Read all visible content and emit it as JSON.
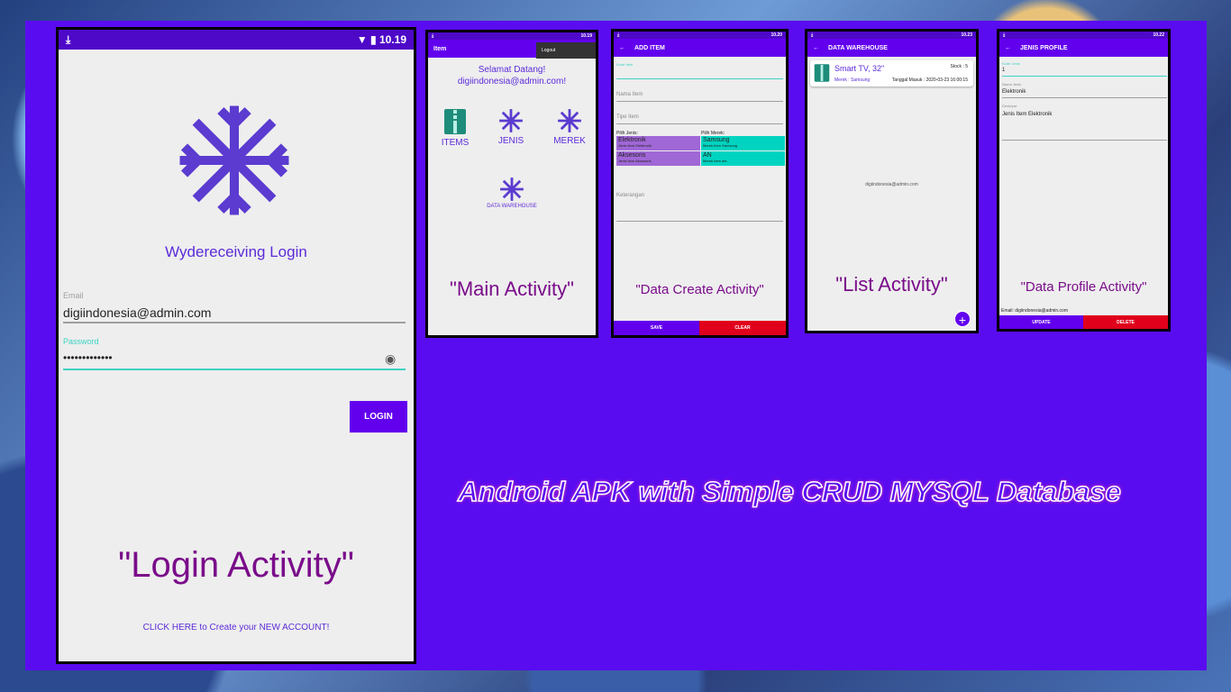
{
  "login": {
    "status_time": "10.19",
    "title": "Wydereceiving Login",
    "email_label": "Email",
    "email_value": "digiindonesia@admin.com",
    "password_label": "Password",
    "password_value": "•••••••••••••",
    "login_button": "LOGIN",
    "create_link": "CLICK HERE to Create your NEW ACCOUNT!",
    "caption": "\"Login Activity\""
  },
  "main": {
    "status_time": "10.19",
    "appbar_title": "Item",
    "logout": "Logout",
    "welcome_line1": "Selamat Datang!",
    "welcome_line2": "digiindonesia@admin.com!",
    "items": "ITEMS",
    "jenis": "JENIS",
    "merek": "MEREK",
    "warehouse": "DATA WAREHOUSE",
    "caption": "\"Main Activity\""
  },
  "create": {
    "status_time": "10.20",
    "appbar_title": "ADD ITEM",
    "kode_label": "Kode Item",
    "nama_label": "Nama Item",
    "tipe_label": "Tipe Item",
    "pilih_jenis": "Pilih Jenis:",
    "pilih_merek": "Pilih Merek:",
    "jenis_options": [
      {
        "name": "Elektronik",
        "desc": "Jenis Item Elektronik"
      },
      {
        "name": "Aksesoris",
        "desc": "Jenis Item Aksesoris"
      }
    ],
    "merek_options": [
      {
        "name": "Samsung",
        "desc": "Merek Item Samsung"
      },
      {
        "name": "AN",
        "desc": "Merek Item afs"
      }
    ],
    "keterangan_label": "Keterangan",
    "save": "SAVE",
    "clear": "CLEAR",
    "caption": "\"Data Create Activity\""
  },
  "list": {
    "status_time": "10.23",
    "appbar_title": "DATA WAREHOUSE",
    "item_name": "Smart TV, 32\"",
    "stock": "Stock : 5",
    "merek": "Merek : Samsung",
    "tanggal": "Tanggal Masuk : 2020-03-23 16:00:15",
    "email": "digiindonesia@admin.com",
    "caption": "\"List Activity\""
  },
  "profile": {
    "status_time": "10.22",
    "appbar_title": "JENIS PROFILE",
    "kode_label": "Kode Jenis",
    "kode_value": "1",
    "nama_label": "Nama Jenis",
    "nama_value": "Elektronik",
    "desk_label": "Deskripsi",
    "desk_value": "Jenis Item Elektronik",
    "email": "Email: digiindonesia@admin.com",
    "update": "UPDATE",
    "delete": "DELETE",
    "caption": "\"Data Profile Activity\""
  },
  "headline": "Android APK with Simple CRUD MYSQL Database",
  "colors": {
    "board": "#5a0cf0",
    "appbar": "#6200ee",
    "caption": "#7a0c8a",
    "jenis_cell": "#a067d6",
    "merek_cell": "#00d4c0",
    "delete_red": "#e0001b"
  }
}
